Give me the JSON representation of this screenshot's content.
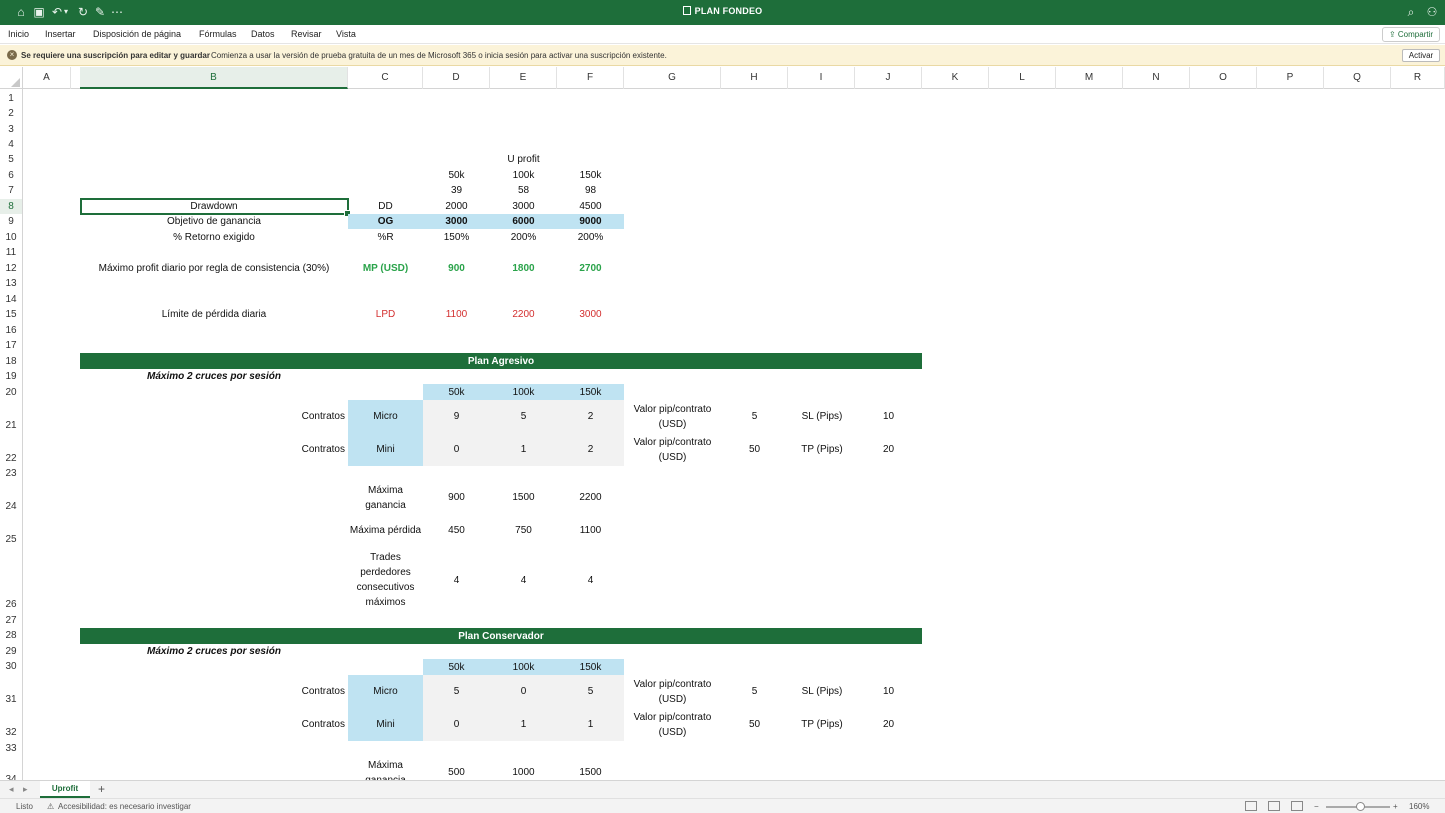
{
  "app": {
    "title": "PLAN FONDEO",
    "share_label": "Compartir",
    "menu": [
      "Inicio",
      "Insertar",
      "Disposición de página",
      "Fórmulas",
      "Datos",
      "Revisar",
      "Vista"
    ],
    "notice_bold": "Se requiere una suscripción para editar y guardar",
    "notice_text": "Comienza a usar la versión de prueba gratuita de un mes de Microsoft 365 o inicia sesión para activar una suscripción existente.",
    "notice_button": "Activar",
    "sheet_tab": "Uprofit",
    "status_ready": "Listo",
    "status_accessibility": "Accesibilidad: es necesario investigar",
    "zoom": "160%"
  },
  "columns": [
    "A",
    "B",
    "C",
    "D",
    "E",
    "F",
    "G",
    "H",
    "I",
    "J",
    "K",
    "L",
    "M",
    "N",
    "O",
    "P",
    "Q",
    "R"
  ],
  "rows": [
    "1",
    "2",
    "3",
    "4",
    "5",
    "6",
    "7",
    "8",
    "9",
    "10",
    "11",
    "12",
    "13",
    "14",
    "15",
    "16",
    "17",
    "18",
    "19",
    "20",
    "21",
    "22",
    "23",
    "24",
    "25",
    "26",
    "27",
    "28",
    "29",
    "30",
    "31",
    "32",
    "33",
    "34"
  ],
  "top": {
    "u_profit": "U profit",
    "sizes": [
      "50k",
      "100k",
      "150k"
    ],
    "r7": [
      "39",
      "58",
      "98"
    ],
    "drawdown": {
      "label": "Drawdown",
      "code": "DD",
      "values": [
        "2000",
        "3000",
        "4500"
      ]
    },
    "objetivo": {
      "label": "Objetivo de ganancia",
      "code": "OG",
      "values": [
        "3000",
        "6000",
        "9000"
      ]
    },
    "retorno": {
      "label": "% Retorno exigido",
      "code": "%R",
      "values": [
        "150%",
        "200%",
        "200%"
      ]
    },
    "maximo": {
      "label": "Máximo profit diario por regla de consistencia (30%)",
      "code": "MP (USD)",
      "values": [
        "900",
        "1800",
        "2700"
      ]
    },
    "limite": {
      "label": "Límite de pérdida diaria",
      "code": "LPD",
      "values": [
        "1100",
        "2200",
        "3000"
      ]
    }
  },
  "agresivo": {
    "title": "Plan Agresivo",
    "subtitle": "Máximo 2 cruces por sesión",
    "sizes": [
      "50k",
      "100k",
      "150k"
    ],
    "contratos": "Contratos",
    "micro": {
      "label": "Micro",
      "values": [
        "9",
        "5",
        "2"
      ]
    },
    "mini": {
      "label": "Mini",
      "values": [
        "0",
        "1",
        "2"
      ]
    },
    "pip1": "Valor pip/contrato (USD)",
    "pip1_val": "5",
    "sl": "SL (Pips)",
    "sl_val": "10",
    "pip2": "Valor pip/contrato (USD)",
    "pip2_val": "50",
    "tp": "TP (Pips)",
    "tp_val": "20",
    "max_gan": {
      "label": "Máxima ganancia",
      "values": [
        "900",
        "1500",
        "2200"
      ]
    },
    "max_per": {
      "label": "Máxima pérdida",
      "values": [
        "450",
        "750",
        "1100"
      ]
    },
    "trades": {
      "label": "Trades perdedores consecutivos máximos",
      "values": [
        "4",
        "4",
        "4"
      ]
    }
  },
  "conservador": {
    "title": "Plan Conservador",
    "subtitle": "Máximo 2 cruces por sesión",
    "sizes": [
      "50k",
      "100k",
      "150k"
    ],
    "contratos": "Contratos",
    "micro": {
      "label": "Micro",
      "values": [
        "5",
        "0",
        "5"
      ]
    },
    "mini": {
      "label": "Mini",
      "values": [
        "0",
        "1",
        "1"
      ]
    },
    "pip1": "Valor pip/contrato (USD)",
    "pip1_val": "5",
    "sl": "SL (Pips)",
    "sl_val": "10",
    "pip2": "Valor pip/contrato (USD)",
    "pip2_val": "50",
    "tp": "TP (Pips)",
    "tp_val": "20",
    "max_gan": {
      "label": "Máxima ganancia",
      "values": [
        "500",
        "1000",
        "1500"
      ]
    }
  }
}
